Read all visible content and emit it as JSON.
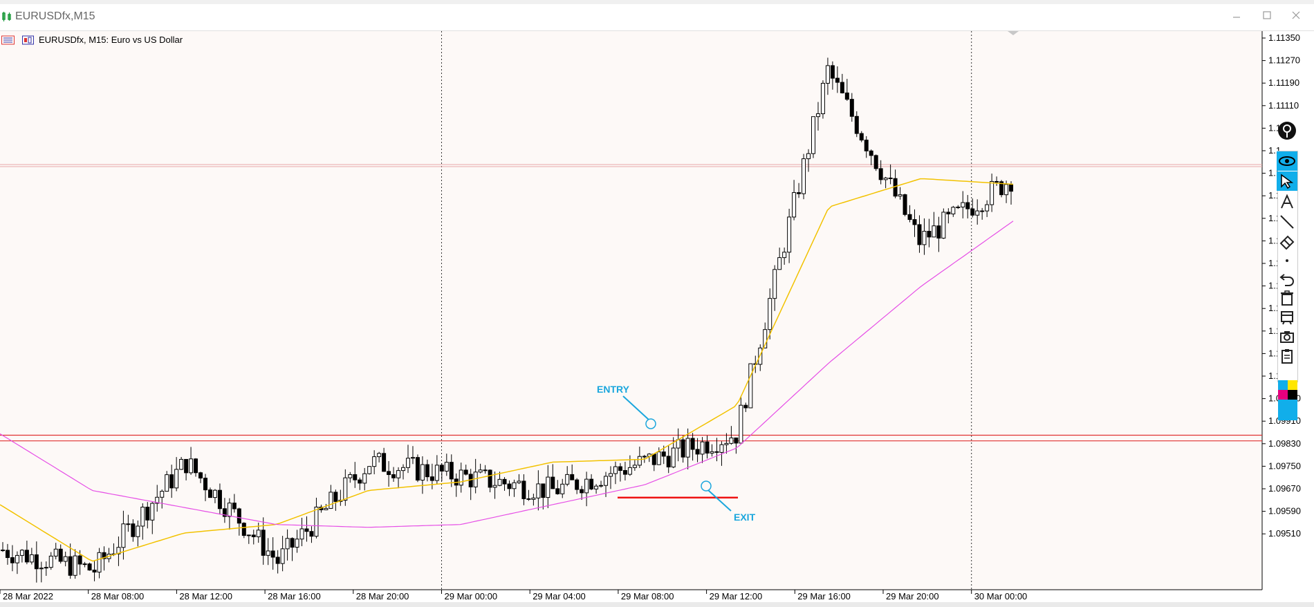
{
  "window": {
    "title": "EURUSDfx,M15",
    "minimize_icon": "minimize-icon",
    "maximize_icon": "maximize-icon",
    "close_icon": "close-icon"
  },
  "chart_header": {
    "label": "EURUSDfx, M15:  Euro vs US Dollar"
  },
  "price_axis": {
    "labels": [
      "1.11350",
      "1.11270",
      "1.11190",
      "1.11110",
      "1.1",
      "1.1",
      "1.1",
      "1.1",
      "1.1",
      "1.1",
      "1.1",
      "1.1",
      "1.1",
      "1.1",
      "1.1",
      "1.1",
      "1.09990",
      "1.09910",
      "1.09830",
      "1.09750",
      "1.09670",
      "1.09590",
      "1.09510"
    ]
  },
  "time_axis": {
    "labels": [
      "28 Mar 2022",
      "28 Mar 08:00",
      "28 Mar 12:00",
      "28 Mar 16:00",
      "28 Mar 20:00",
      "29 Mar 00:00",
      "29 Mar 04:00",
      "29 Mar 08:00",
      "29 Mar 12:00",
      "29 Mar 16:00",
      "29 Mar 20:00",
      "30 Mar 00:00"
    ]
  },
  "annotations": {
    "entry": "ENTRY",
    "exit": "EXIT"
  },
  "toolbar": {
    "items": [
      "pin-icon",
      "eye-icon",
      "cursor-icon",
      "text-icon",
      "line-icon",
      "eraser-icon",
      "dot-icon",
      "undo-icon",
      "trash-icon",
      "templates-icon",
      "camera-icon",
      "clipboard-icon",
      "color-palette-icon"
    ]
  },
  "colors": {
    "background": "#fdf9f7",
    "fast_ma": "#f2c200",
    "slow_ma": "#e64ee6",
    "support_lines": "#e03030",
    "exit_line": "#ee1111",
    "annotation": "#1aa6dd",
    "toolbar_accent": "#11aeea"
  },
  "chart_data": {
    "type": "candlestick",
    "symbol": "EURUSDfx",
    "timeframe": "M15",
    "ylim": [
      1.0945,
      1.1142
    ],
    "grid": false,
    "horizontal_lines": [
      1.09995,
      1.09975
    ],
    "exit_price": 1.09775,
    "vertical_separators": [
      "29 Mar 00:00",
      "30 Mar 00:00"
    ],
    "series": [
      {
        "name": "close_path",
        "x": [
          "28 Mar 04:00",
          "28 Mar 08:00",
          "28 Mar 12:00",
          "28 Mar 16:00",
          "28 Mar 20:00",
          "29 Mar 00:00",
          "29 Mar 04:00",
          "29 Mar 08:00",
          "29 Mar 12:00",
          "29 Mar 16:00",
          "29 Mar 20:00",
          "30 Mar 00:00"
        ],
        "values": [
          1.0959,
          1.0952,
          1.099,
          1.0955,
          1.099,
          1.0985,
          1.098,
          1.099,
          1.1,
          1.1128,
          1.1068,
          1.109
        ]
      },
      {
        "name": "fast_ma",
        "values": [
          1.0975,
          1.0955,
          1.0965,
          1.0968,
          1.098,
          1.0983,
          1.099,
          1.0991,
          1.101,
          1.108,
          1.109,
          1.1088
        ]
      },
      {
        "name": "slow_ma",
        "values": [
          1.1,
          1.098,
          1.0974,
          1.0968,
          1.0967,
          1.0968,
          1.0975,
          1.0982,
          1.0995,
          1.1025,
          1.1052,
          1.1075
        ]
      }
    ]
  }
}
